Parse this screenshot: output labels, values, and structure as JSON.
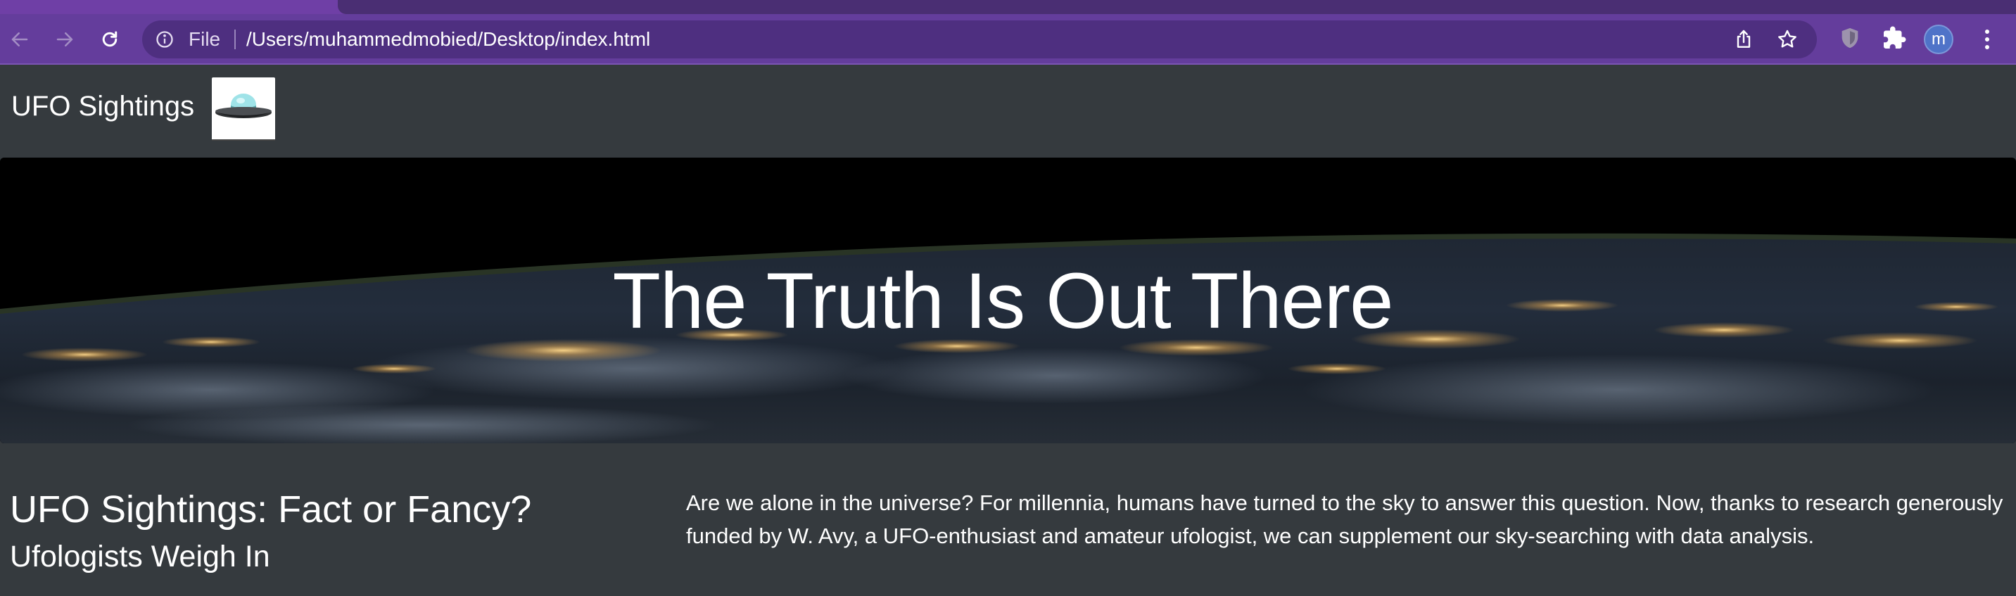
{
  "browser": {
    "omnibox": {
      "scheme_label": "File",
      "url": "/Users/muhammedmobied/Desktop/index.html"
    },
    "profile_initial": "m",
    "icons": [
      "back-icon",
      "forward-icon",
      "reload-icon",
      "info-icon",
      "share-icon",
      "star-icon",
      "shield-extension-icon",
      "puzzle-extensions-icon",
      "menu-icon"
    ]
  },
  "navbar": {
    "brand": "UFO Sightings",
    "logo_icon": "ufo-saucer-icon"
  },
  "hero": {
    "title": "The Truth Is Out There"
  },
  "main": {
    "heading": "UFO Sightings: Fact or Fancy?",
    "subheading": "Ufologists Weigh In",
    "intro": "Are we alone in the universe? For millennia, humans have turned to the sky to answer this question. Now, thanks to research generously funded by W. Avy, a UFO-enthusiast and amateur ufologist, we can supplement our sky-searching with data analysis."
  },
  "colors": {
    "chrome_purple": "#643d9c",
    "omnibox_purple": "#4e2f80",
    "page_background": "#353a3e",
    "text": "#ffffff"
  }
}
